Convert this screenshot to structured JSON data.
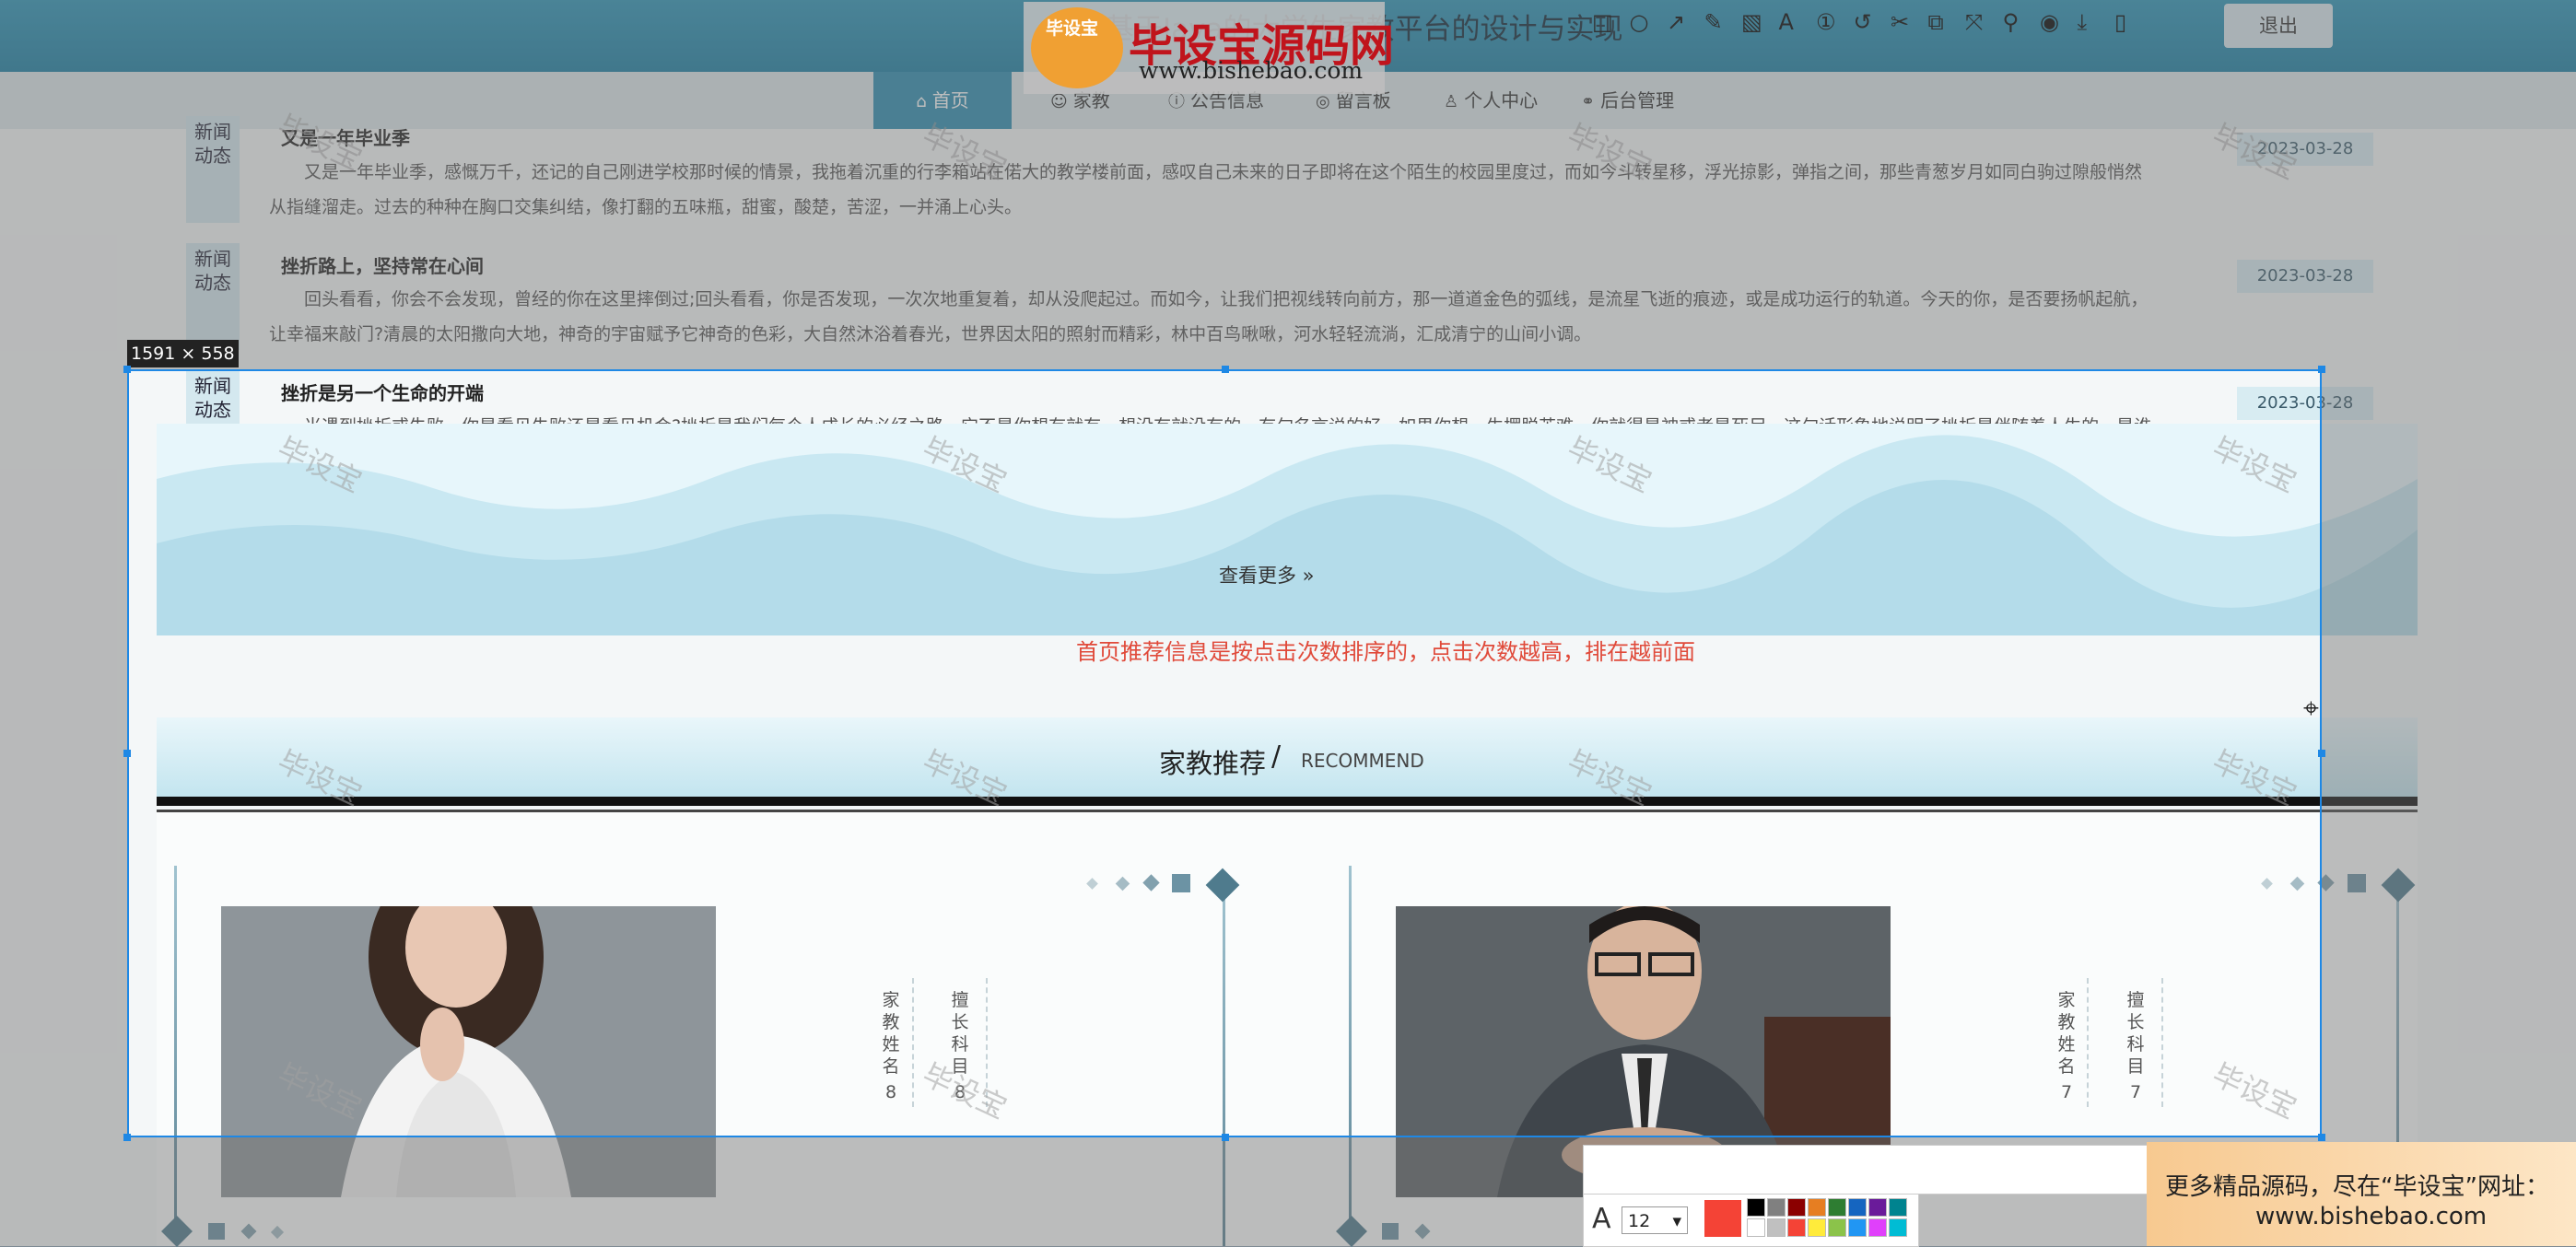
{
  "header": {
    "site_title": "基于Java的大学生家教平台的设计与实现",
    "logout_label": "退出"
  },
  "nav": [
    {
      "label": "首页",
      "icon": "home-icon",
      "glyph": "⌂"
    },
    {
      "label": "家教",
      "icon": "teacher-icon",
      "glyph": "☺"
    },
    {
      "label": "公告信息",
      "icon": "info-icon",
      "glyph": "ⓘ"
    },
    {
      "label": "留言板",
      "icon": "message-icon",
      "glyph": "◎"
    },
    {
      "label": "个人中心",
      "icon": "user-icon",
      "glyph": "♙"
    },
    {
      "label": "后台管理",
      "icon": "link-icon",
      "glyph": "⚭"
    }
  ],
  "news": [
    {
      "tag": "新闻动态",
      "title": "又是一年毕业季",
      "body": "又是一年毕业季，感慨万千，还记的自己刚进学校那时候的情景，我拖着沉重的行李箱站在偌大的教学楼前面，感叹自己未来的日子即将在这个陌生的校园里度过，而如今斗转星移，浮光掠影，弹指之间，那些青葱岁月如同白驹过隙般悄然从指缝溜走。过去的种种在胸口交集纠结，像打翻的五味瓶，甜蜜，酸楚，苦涩，一并涌上心头。",
      "date": "2023-03-28"
    },
    {
      "tag": "新闻动态",
      "title": "挫折路上，坚持常在心间",
      "body": "回头看看，你会不会发现，曾经的你在这里摔倒过;回头看看，你是否发现，一次次地重复着，却从没爬起过。而如今，让我们把视线转向前方，那一道道金色的弧线，是流星飞逝的痕迹，或是成功运行的轨道。今天的你，是否要扬帆起航，让幸福来敲门?清晨的太阳撒向大地，神奇的宇宙赋予它神奇的色彩，大自然沐浴着春光，世界因太阳的照射而精彩，林中百鸟啾啾，河水轻轻流淌，汇成清宁的山间小调。",
      "date": "2023-03-28"
    },
    {
      "tag": "新闻动态",
      "title": "挫折是另一个生命的开端",
      "body": "当遇到挫折或失败，你是看见失败还是看见机会?挫折是我们每个人成长的必经之路，它不是你想有就有，想没有就没有的。有句名言说的好，如果你想一生摆脱苦难，你就得是神或者是死尸。这句话形象地说明了挫折是伴随着人生的，是谁都逃不掉的。",
      "date": "2023-03-28"
    }
  ],
  "more_label": "查看更多 »",
  "notice": "首页推荐信息是按点击次数排序的，点击次数越高，排在越前面",
  "recommend": {
    "title": "家教推荐",
    "slash": "/",
    "subtitle": "RECOMMEND",
    "cards": [
      {
        "name_label": "家教姓名",
        "name_value": "8",
        "subject_label": "擅长科目",
        "subject_value": "8"
      },
      {
        "name_label": "家教姓名",
        "name_value": "7",
        "subject_label": "擅长科目",
        "subject_value": "7"
      }
    ]
  },
  "capture": {
    "size_label": "1591 × 558",
    "font_size": "12",
    "font_glyph": "A",
    "current_color": "#f44336",
    "palette": [
      "#000000",
      "#808080",
      "#8b0000",
      "#e67e22",
      "#2e7d32",
      "#1565c0",
      "#6a1b9a",
      "#00838f",
      "#ffffff",
      "#c0c0c0",
      "#f44336",
      "#ffeb3b",
      "#8bc34a",
      "#2196f3",
      "#e040fb",
      "#00bcd4"
    ],
    "tools": [
      {
        "icon": "rectangle-icon",
        "glyph": "□"
      },
      {
        "icon": "ellipse-icon",
        "glyph": "○"
      },
      {
        "icon": "arrow-icon",
        "glyph": "↗"
      },
      {
        "icon": "pencil-icon",
        "glyph": "✎"
      },
      {
        "icon": "mosaic-icon",
        "glyph": "▧"
      },
      {
        "icon": "text-icon",
        "glyph": "A"
      },
      {
        "icon": "counter-icon",
        "glyph": "①"
      },
      {
        "icon": "undo-icon",
        "glyph": "↺"
      },
      {
        "icon": "crop-icon",
        "glyph": "✂"
      },
      {
        "icon": "ocr-icon",
        "glyph": "⧉"
      },
      {
        "icon": "translate-icon",
        "glyph": "⤧"
      },
      {
        "icon": "pin-icon",
        "glyph": "⚲"
      },
      {
        "icon": "record-icon",
        "glyph": "◉"
      },
      {
        "icon": "save-icon",
        "glyph": "⤓"
      },
      {
        "icon": "copy-icon",
        "glyph": "▯"
      }
    ]
  },
  "watermark": {
    "logo_badge": "毕设宝",
    "logo_cn": "毕设宝源码网",
    "logo_url": "www.bishebao.com",
    "tile_text": "毕设宝",
    "promo_line1": "更多精品源码，尽在“毕设宝”网址：",
    "promo_line2": "www.bishebao.com"
  }
}
